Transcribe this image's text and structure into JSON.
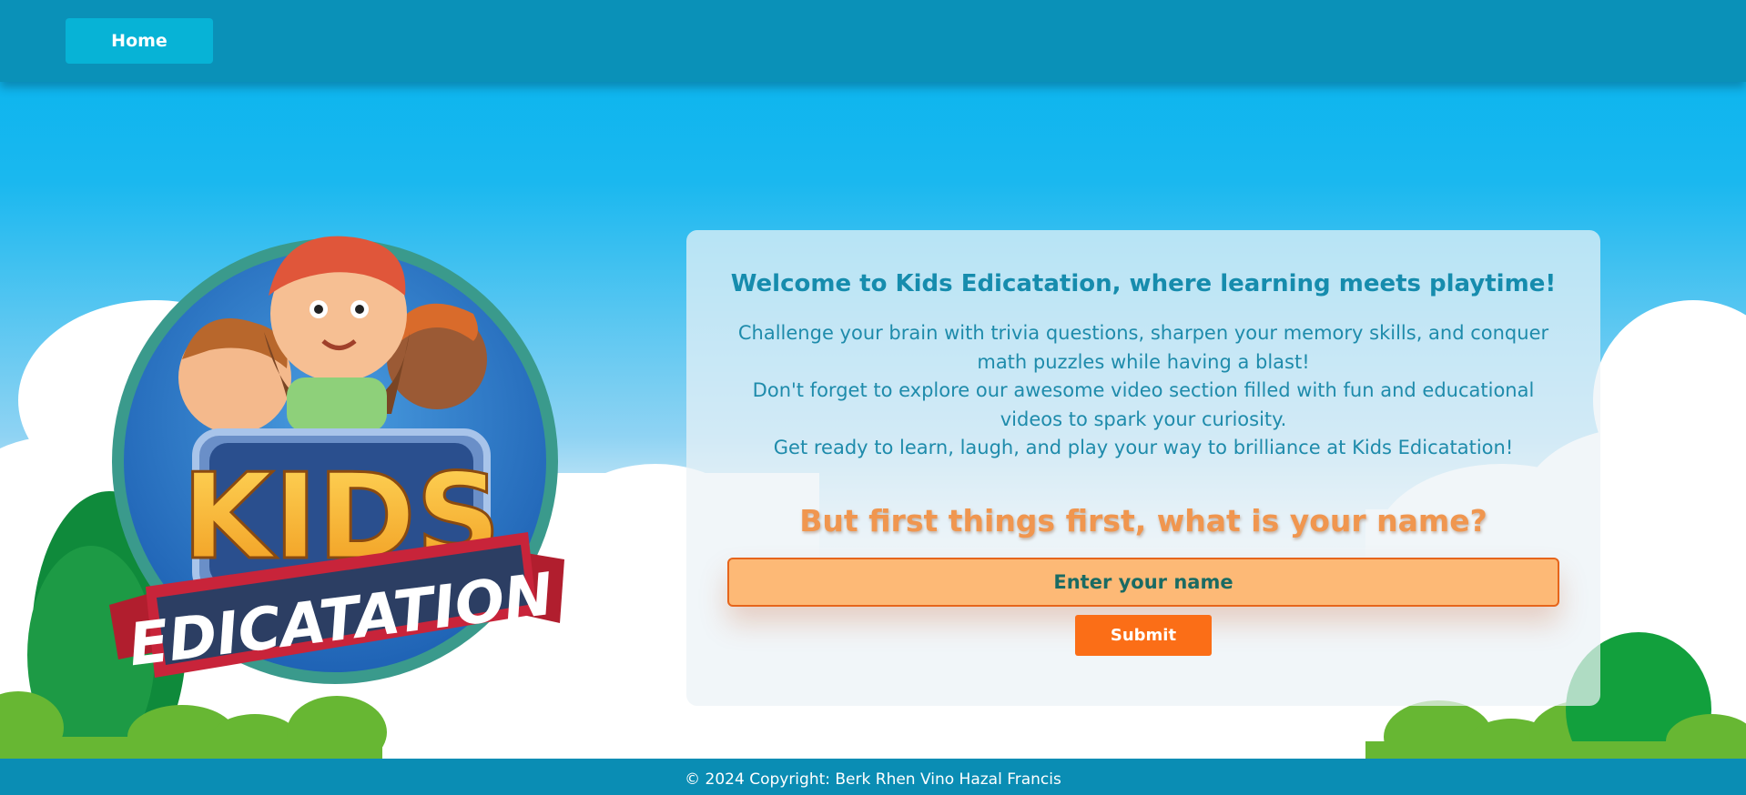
{
  "nav": {
    "home_label": "Home"
  },
  "logo": {
    "line1": "KIDS",
    "line2": "EDICATATION"
  },
  "welcome": {
    "title": "Welcome to Kids Edicatation, where learning meets playtime!",
    "paragraphs": [
      "Challenge your brain with trivia questions, sharpen your memory skills, and conquer math puzzles while having a blast!",
      "Don't forget to explore our awesome video section filled with fun and educational videos to spark your curiosity.",
      "Get ready to learn, laugh, and play your way to brilliance at Kids Edicatation!"
    ]
  },
  "form": {
    "question": "But first things first, what is your name?",
    "name_placeholder": "Enter your name",
    "name_value": "",
    "submit_label": "Submit"
  },
  "footer": {
    "copyright": "© 2024 Copyright: Berk Rhen Vino Hazal Francis"
  },
  "colors": {
    "nav_bg": "#0a91b8",
    "home_button": "#07b3d6",
    "sky": "#04b3ee",
    "title_text": "#168cad",
    "question_text": "#f0964f",
    "input_bg": "#fdb976",
    "input_border": "#e6651b",
    "submit_bg": "#fb6e17",
    "footer_bg": "#0a8db4"
  }
}
